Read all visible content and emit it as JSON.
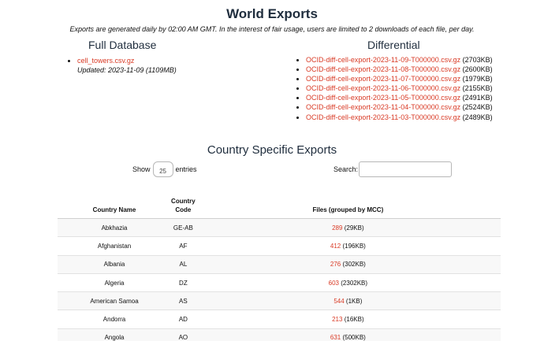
{
  "header": {
    "title": "World Exports",
    "subtitle": "Exports are generated daily by 02:00 AM GMT. In the interest of fair usage, users are limited to 2 downloads of each file, per day."
  },
  "full_database": {
    "title": "Full Database",
    "file": "cell_towers.csv.gz",
    "updated": "Updated: 2023-11-09 (1109MB)"
  },
  "differential": {
    "title": "Differential",
    "files": [
      {
        "name": "OCID-diff-cell-export-2023-11-09-T000000.csv.gz",
        "size": "(2703KB)"
      },
      {
        "name": "OCID-diff-cell-export-2023-11-08-T000000.csv.gz",
        "size": "(2600KB)"
      },
      {
        "name": "OCID-diff-cell-export-2023-11-07-T000000.csv.gz",
        "size": "(1979KB)"
      },
      {
        "name": "OCID-diff-cell-export-2023-11-06-T000000.csv.gz",
        "size": "(2155KB)"
      },
      {
        "name": "OCID-diff-cell-export-2023-11-05-T000000.csv.gz",
        "size": "(2491KB)"
      },
      {
        "name": "OCID-diff-cell-export-2023-11-04-T000000.csv.gz",
        "size": "(2524KB)"
      },
      {
        "name": "OCID-diff-cell-export-2023-11-03-T000000.csv.gz",
        "size": "(2489KB)"
      }
    ]
  },
  "country_section": {
    "title": "Country Specific Exports",
    "show_label": "Show",
    "entries_value": "25",
    "entries_label": "entries",
    "search_label": "Search:",
    "search_value": ""
  },
  "table": {
    "headers": [
      "Country Name",
      "Country Code",
      "Files (grouped by MCC)"
    ],
    "rows": [
      {
        "name": "Abkhazia",
        "code": "GE-AB",
        "mcc": "289",
        "size": "(29KB)"
      },
      {
        "name": "Afghanistan",
        "code": "AF",
        "mcc": "412",
        "size": "(196KB)"
      },
      {
        "name": "Albania",
        "code": "AL",
        "mcc": "276",
        "size": "(302KB)"
      },
      {
        "name": "Algeria",
        "code": "DZ",
        "mcc": "603",
        "size": "(2302KB)"
      },
      {
        "name": "American Samoa",
        "code": "AS",
        "mcc": "544",
        "size": "(1KB)"
      },
      {
        "name": "Andorra",
        "code": "AD",
        "mcc": "213",
        "size": "(16KB)"
      },
      {
        "name": "Angola",
        "code": "AO",
        "mcc": "631",
        "size": "(500KB)"
      }
    ]
  },
  "colors": {
    "link": "#d93a25",
    "heading": "#1f2d3d",
    "row_stripe": "#f8f8f8"
  }
}
